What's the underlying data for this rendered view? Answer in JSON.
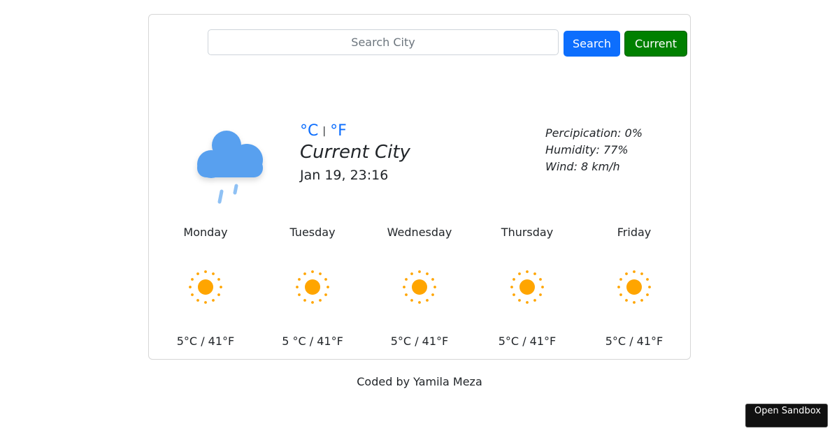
{
  "search": {
    "placeholder": "Search City",
    "value": "",
    "search_label": "Search",
    "current_label": "Current"
  },
  "current": {
    "icon": "rain-cloud-icon",
    "unit_celsius": "°C",
    "unit_separator": "|",
    "unit_fahrenheit": "°F",
    "city": "Current City",
    "date": "Jan 19, 23:16",
    "precipitation": "Percipication: 0%",
    "humidity": "Humidity: 77%",
    "wind": "Wind: 8 km/h"
  },
  "forecast": [
    {
      "day": "Monday",
      "icon": "sun-icon",
      "temp": "5°C / 41°F"
    },
    {
      "day": "Tuesday",
      "icon": "sun-icon",
      "temp": "5 °C / 41°F"
    },
    {
      "day": "Wednesday",
      "icon": "sun-icon",
      "temp": "5°C / 41°F"
    },
    {
      "day": "Thursday",
      "icon": "sun-icon",
      "temp": "5°C / 41°F"
    },
    {
      "day": "Friday",
      "icon": "sun-icon",
      "temp": "5°C / 41°F"
    }
  ],
  "footer": {
    "text": "Coded by Yamila Meza"
  },
  "sandbox": {
    "label": "Open Sandbox"
  },
  "colors": {
    "primary": "#0d6efd",
    "success": "#008000",
    "sun": "#ffa500",
    "cloud": "#58a0ef",
    "rain": "#8fc1f4"
  }
}
